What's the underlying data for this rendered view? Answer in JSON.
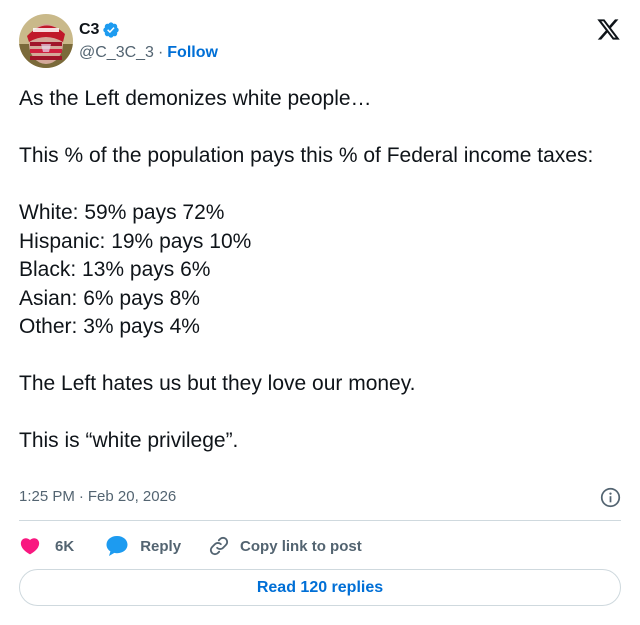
{
  "author": {
    "display_name": "C3",
    "handle": "@C_3C_3",
    "separator": "·",
    "follow_label": "Follow",
    "verified_color": "#1d9bf0"
  },
  "tweet": {
    "text": "As the Left demonizes white people…\n\nThis % of the population pays this % of Federal income taxes:\n\nWhite: 59% pays 72%\nHispanic: 19% pays 10%\nBlack: 13% pays 6%\nAsian: 6% pays 8%\nOther: 3% pays 4%\n\nThe Left hates us but they love our money.\n\nThis is “white privilege”.",
    "time": "1:25 PM",
    "separator": "·",
    "date": "Feb 20, 2026"
  },
  "actions": {
    "like_count": "6K",
    "reply_label": "Reply",
    "copy_label": "Copy link to post",
    "like_color": "#f91880",
    "reply_color": "#1d9bf0"
  },
  "footer": {
    "read_replies_label": "Read 120 replies"
  },
  "icons": {
    "brand": "x-logo-icon",
    "verified": "verified-badge-icon",
    "info": "info-icon",
    "like": "heart-icon",
    "reply": "speech-bubble-icon",
    "copy": "link-icon"
  }
}
